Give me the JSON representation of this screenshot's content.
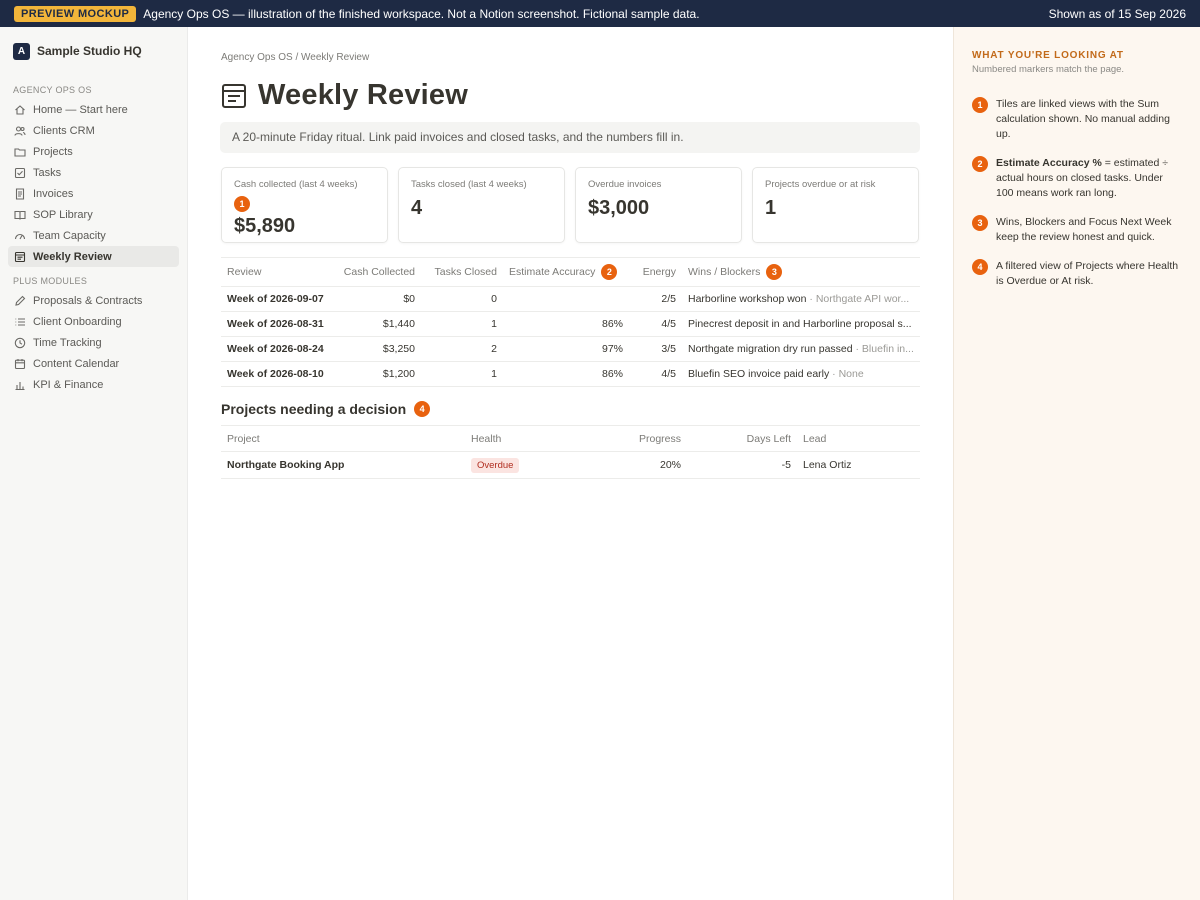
{
  "banner": {
    "tag": "PREVIEW MOCKUP",
    "message": "Agency Ops OS — illustration of the finished workspace. Not a Notion screenshot. Fictional sample data.",
    "shown_as_of": "Shown as of 15 Sep 2026"
  },
  "sidebar": {
    "workspace_initial": "A",
    "workspace_name": "Sample Studio HQ",
    "section1_label": "AGENCY OPS OS",
    "section1_items": [
      {
        "label": "Home — Start here",
        "icon": "home-icon"
      },
      {
        "label": "Clients CRM",
        "icon": "users-icon"
      },
      {
        "label": "Projects",
        "icon": "folder-icon"
      },
      {
        "label": "Tasks",
        "icon": "checkbox-icon"
      },
      {
        "label": "Invoices",
        "icon": "receipt-icon"
      },
      {
        "label": "SOP Library",
        "icon": "book-icon"
      },
      {
        "label": "Team Capacity",
        "icon": "gauge-icon"
      },
      {
        "label": "Weekly Review",
        "icon": "calendar-list-icon"
      }
    ],
    "section2_label": "PLUS MODULES",
    "section2_items": [
      {
        "label": "Proposals & Contracts",
        "icon": "pen-icon"
      },
      {
        "label": "Client Onboarding",
        "icon": "list-icon"
      },
      {
        "label": "Time Tracking",
        "icon": "clock-icon"
      },
      {
        "label": "Content Calendar",
        "icon": "calendar-icon"
      },
      {
        "label": "KPI & Finance",
        "icon": "bar-chart-icon"
      }
    ]
  },
  "page": {
    "breadcrumb": "Agency Ops OS / Weekly Review",
    "title": "Weekly Review",
    "callout": "A 20-minute Friday ritual. Link paid invoices and closed tasks, and the numbers fill in."
  },
  "tiles": [
    {
      "label": "Cash collected (last 4 weeks)",
      "value": "$5,890",
      "marker": "1"
    },
    {
      "label": "Tasks closed (last 4 weeks)",
      "value": "4"
    },
    {
      "label": "Overdue invoices",
      "value": "$3,000"
    },
    {
      "label": "Projects overdue or at risk",
      "value": "1"
    }
  ],
  "review_table": {
    "headers": [
      "Review",
      "Cash Collected",
      "Tasks Closed",
      "Estimate Accuracy",
      "Energy",
      "Wins / Blockers"
    ],
    "accuracy_marker": "2",
    "wins_marker": "3",
    "rows": [
      {
        "week": "Week of 2026-09-07",
        "cash": "$0",
        "tasks": "0",
        "accuracy": "",
        "energy": "2/5",
        "win": "Harborline workshop won",
        "blocker": " · Northgate API wor..."
      },
      {
        "week": "Week of 2026-08-31",
        "cash": "$1,440",
        "tasks": "1",
        "accuracy": "86%",
        "energy": "4/5",
        "win": "Pinecrest deposit in and Harborline proposal s...",
        "blocker": ""
      },
      {
        "week": "Week of 2026-08-24",
        "cash": "$3,250",
        "tasks": "2",
        "accuracy": "97%",
        "energy": "3/5",
        "win": "Northgate migration dry run passed",
        "blocker": " · Bluefin in..."
      },
      {
        "week": "Week of 2026-08-10",
        "cash": "$1,200",
        "tasks": "1",
        "accuracy": "86%",
        "energy": "4/5",
        "win": "Bluefin SEO invoice paid early",
        "blocker": " · None"
      }
    ]
  },
  "projects_section": {
    "title": "Projects needing a decision",
    "marker": "4",
    "headers": [
      "Project",
      "Health",
      "Progress",
      "Days Left",
      "Lead"
    ],
    "rows": [
      {
        "project": "Northgate Booking App",
        "health": "Overdue",
        "progress": "20%",
        "days_left": "-5",
        "lead": "Lena Ortiz"
      }
    ]
  },
  "panel": {
    "heading": "WHAT YOU'RE LOOKING AT",
    "subheading": "Numbered markers match the page.",
    "notes": [
      {
        "marker": "1",
        "bold": "",
        "text": "Tiles are linked views with the Sum calculation shown. No manual adding up."
      },
      {
        "marker": "2",
        "bold": "Estimate Accuracy %",
        "text": " = estimated ÷ actual hours on closed tasks. Under 100 means work ran long."
      },
      {
        "marker": "3",
        "bold": "",
        "text": "Wins, Blockers and Focus Next Week keep the review honest and quick."
      },
      {
        "marker": "4",
        "bold": "",
        "text": "A filtered view of Projects where Health is Overdue or At risk."
      }
    ]
  },
  "colors": {
    "banner_bg": "#1e2a44",
    "banner_pill": "#f2b53a",
    "marker": "#e8620f",
    "panel_bg": "#fdf7f0",
    "panel_heading": "#c26a1a",
    "overdue_badge_bg": "#fbe4e1",
    "overdue_badge_text": "#b02d1f"
  }
}
